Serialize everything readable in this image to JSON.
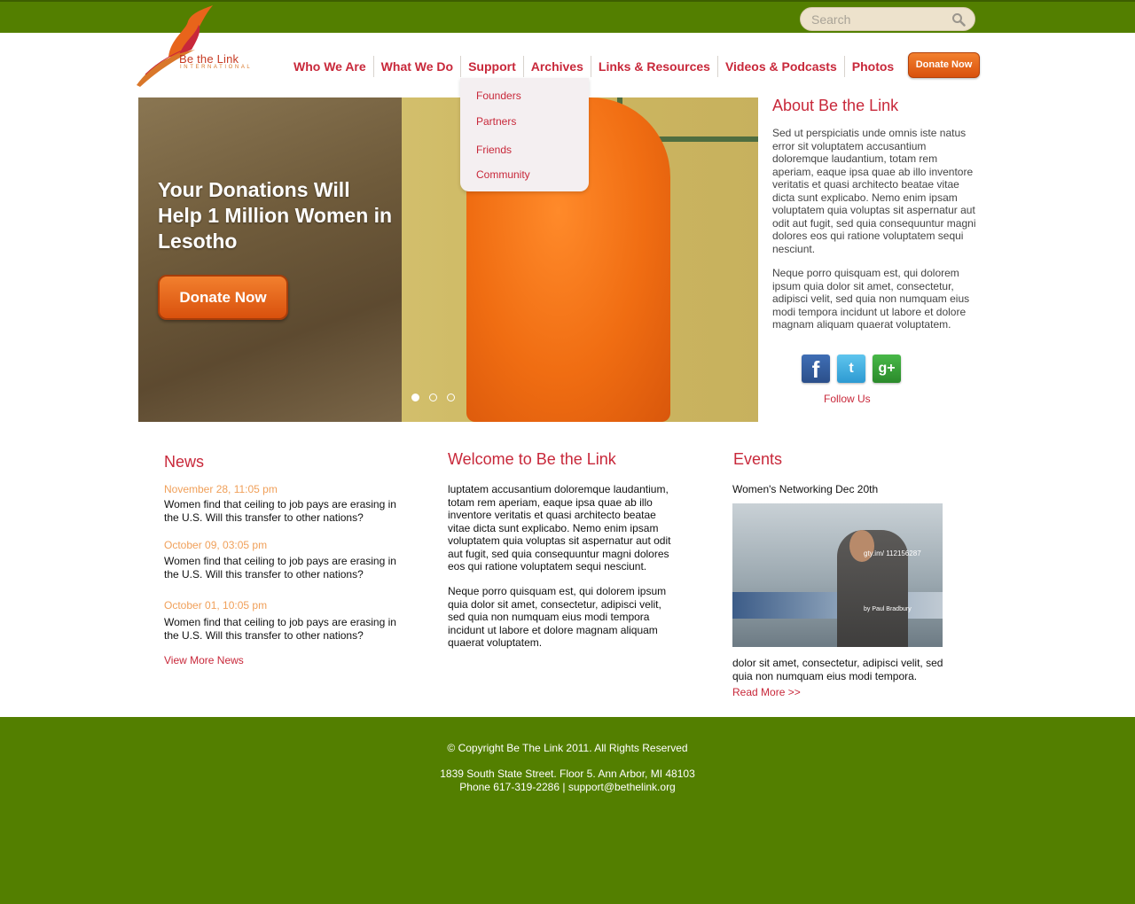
{
  "search": {
    "placeholder": "Search"
  },
  "brand": {
    "name": "Be the Link",
    "tagline": "INTERNATIONAL"
  },
  "nav": [
    {
      "label": "Who We Are"
    },
    {
      "label": "What We Do"
    },
    {
      "label": "Support"
    },
    {
      "label": "Archives"
    },
    {
      "label": "Links & Resources"
    },
    {
      "label": "Videos & Podcasts"
    },
    {
      "label": "Photos"
    }
  ],
  "donate_top_label": "Donate Now",
  "dropdown": [
    {
      "label": "Founders"
    },
    {
      "label": "Partners"
    },
    {
      "label": "Friends"
    },
    {
      "label": "Community"
    }
  ],
  "hero": {
    "title": "Your Donations Will Help 1 Million Women in Lesotho",
    "donate_label": "Donate Now",
    "slides": 3,
    "active_slide": 1
  },
  "about": {
    "title": "About Be the Link",
    "p1": "Sed ut perspiciatis unde omnis iste natus error sit voluptatem accusantium doloremque laudantium, totam rem aperiam, eaque ipsa quae ab illo inventore veritatis et quasi architecto beatae vitae dicta sunt explicabo. Nemo enim ipsam voluptatem quia voluptas sit aspernatur aut odit aut fugit, sed quia consequuntur magni dolores eos qui ratione voluptatem sequi nesciunt.",
    "p2": "Neque porro quisquam est, qui dolorem ipsum quia dolor sit amet, consectetur, adipisci velit, sed quia non numquam eius modi tempora incidunt ut labore et dolore magnam aliquam quaerat voluptatem.",
    "follow": "Follow Us",
    "social": [
      {
        "glyph": "f",
        "icon": "facebook-icon"
      },
      {
        "glyph": "t",
        "icon": "twitter-icon"
      },
      {
        "glyph": "g+",
        "icon": "google-plus-icon"
      }
    ]
  },
  "news": {
    "title": "News",
    "items": [
      {
        "date": "November 28, 11:05 pm",
        "text": "Women find that ceiling to job pays are erasing in the U.S. Will this transfer to other nations?"
      },
      {
        "date": "October 09, 03:05 pm",
        "text": "Women find that ceiling to job pays are erasing in the U.S. Will this transfer to other nations?"
      },
      {
        "date": "October 01, 10:05 pm",
        "text": "Women find that ceiling to job pays are erasing in the U.S. Will this transfer to other nations?"
      }
    ],
    "more": "View More News"
  },
  "welcome": {
    "title": "Welcome to Be the Link",
    "p1": "luptatem accusantium doloremque laudantium, totam rem aperiam, eaque ipsa quae ab illo inventore veritatis et quasi architecto beatae vitae dicta sunt explicabo. Nemo enim ipsam voluptatem quia voluptas sit aspernatur aut odit aut fugit, sed quia consequuntur magni dolores eos qui ratione voluptatem sequi nesciunt.",
    "p2": "Neque porro quisquam est, qui dolorem ipsum quia dolor sit amet, consectetur, adipisci velit, sed quia non numquam eius modi tempora incidunt ut labore et dolore magnam aliquam quaerat voluptatem."
  },
  "events": {
    "title": "Events",
    "heading": "Women's Networking  Dec 20th",
    "image_watermark": "gty.im/ 112156287",
    "image_credit": "by Paul Bradbury",
    "text": "dolor sit amet, consectetur, adipisci velit, sed quia non numquam eius modi tempora.",
    "more": "Read More >>"
  },
  "footer": {
    "copyright": "© Copyright Be The Link 2011. All Rights Reserved",
    "address": "1839 South State Street. Floor 5. Ann Arbor, MI 48103",
    "contact": "Phone 617-319-2286 | support@bethelink.org"
  },
  "colors": {
    "green": "#537f00",
    "red": "#c8283a",
    "orange": "#e8641b",
    "date": "#f0a05a"
  }
}
